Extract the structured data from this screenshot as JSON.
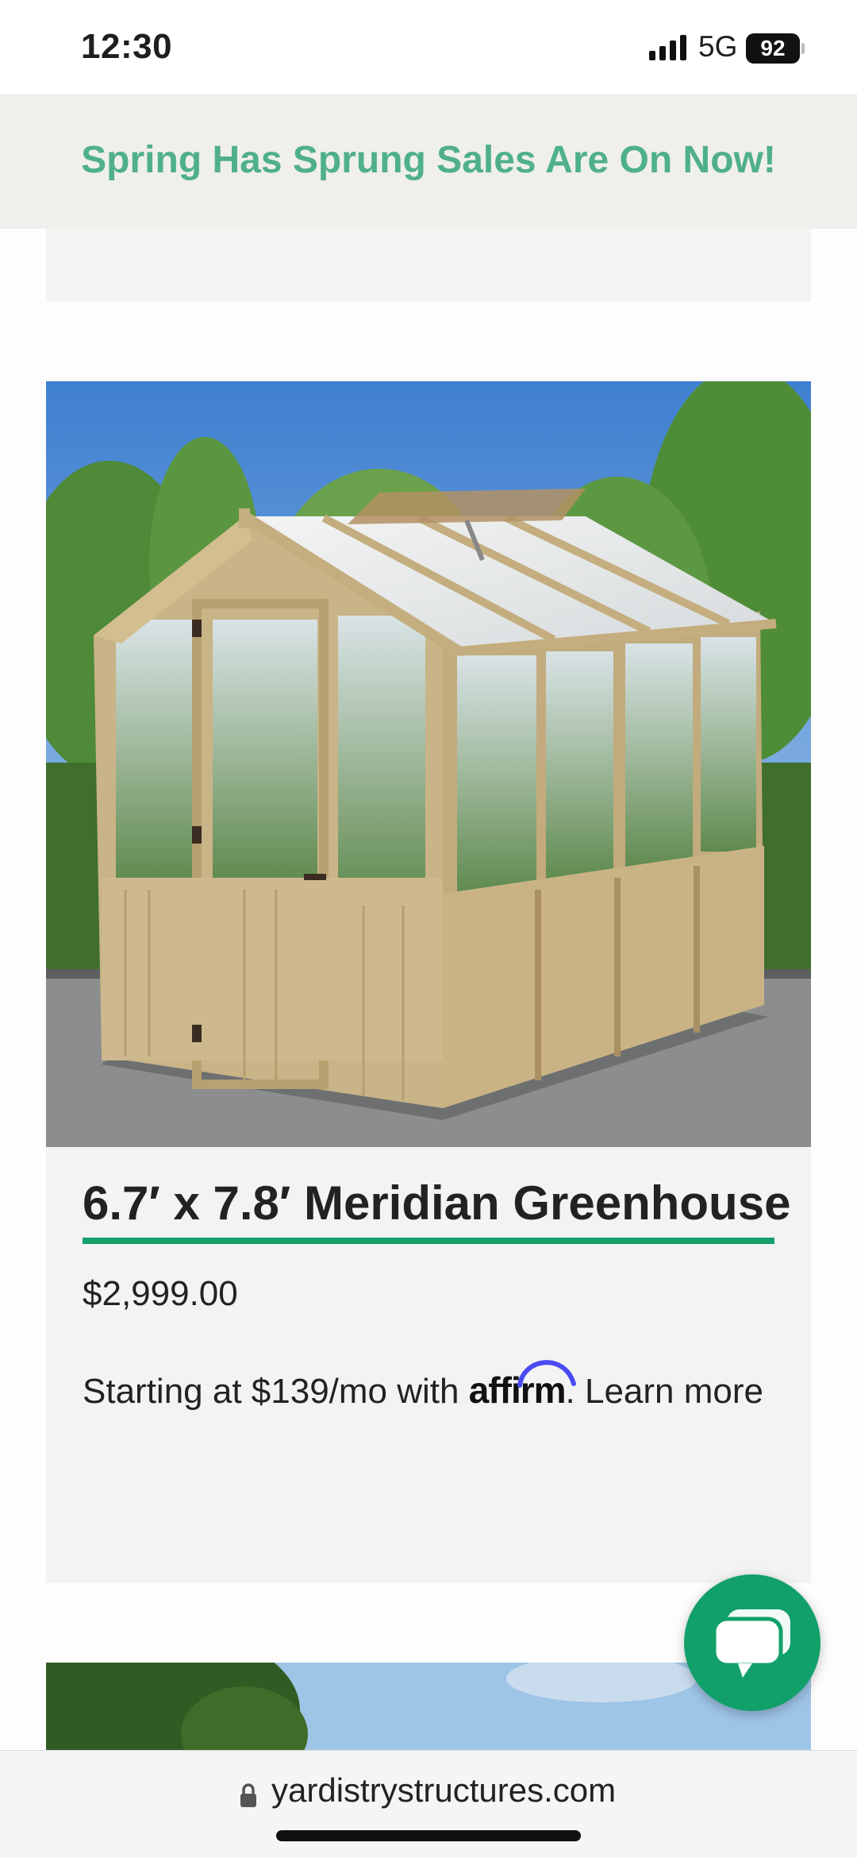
{
  "status_bar": {
    "time": "12:30",
    "network": "5G",
    "battery": "92"
  },
  "promo": {
    "text": "Spring Has Sprung Sales Are On Now!"
  },
  "product": {
    "title": "6.7′ x 7.8′ Meridian Greenhouse",
    "price": "$2,999.00",
    "financing_prefix": "Starting at $139/mo with",
    "financing_brand": "affirm",
    "financing_suffix": ". Learn more"
  },
  "url_bar": {
    "domain": "yardistrystructures.com"
  },
  "icons": {
    "signal": "signal-icon",
    "lock": "lock-icon",
    "chat": "chat-icon"
  },
  "colors": {
    "brand_green": "#13a06a",
    "promo_text": "#4fb08a",
    "promo_bg": "#efefec"
  }
}
